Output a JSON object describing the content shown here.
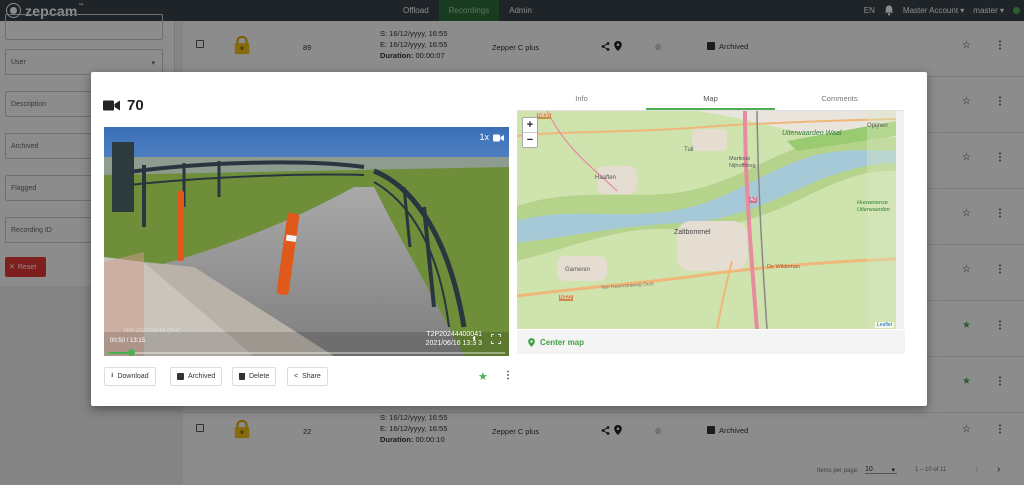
{
  "brand": {
    "name": "zepcam",
    "tm": "™"
  },
  "nav": [
    "Offload",
    "Recordings",
    "Admin"
  ],
  "topbar": {
    "lang": "EN",
    "account": "Master Account",
    "user": "master"
  },
  "filters": {
    "user": "User",
    "description": "Description",
    "archived": "Archived",
    "flagged": "Flagged",
    "recording_id": "Recording ID",
    "reset": "Reset"
  },
  "rows": [
    {
      "id": "89",
      "start": "S: 16/12/yyyy, 16:55",
      "end": "E: 16/12/yyyy, 16:55",
      "duration_label": "Duration:",
      "duration": "00:00:07",
      "device": "Zepper C plus",
      "status": "Archived"
    },
    {
      "id": "22",
      "start": "S: 16/12/yyyy, 16:55",
      "end": "E: 16/12/yyyy, 16:55",
      "duration_label": "Duration:",
      "duration": "00:00:10",
      "device": "Zepper C plus",
      "status": "Archived"
    }
  ],
  "pagination": {
    "label": "Items per page:",
    "per_page": "10",
    "range": "1 – 10 of 11"
  },
  "modal": {
    "title": "70",
    "tabs": [
      "Info",
      "Map",
      "Comments"
    ],
    "video": {
      "speed": "1x",
      "time": "00:50 / 13:15",
      "progress": 0.06,
      "overlay_id": "T2P20244400041",
      "overlay_date": "2021/06/16  13:3 3"
    },
    "buttons": {
      "download": "Download",
      "archived": "Archived",
      "delete": "Delete",
      "share": "Share"
    },
    "center_map": "Center map",
    "map": {
      "places": [
        "Haaften",
        "Tuil",
        "Martinus Nijhoffbrug",
        "Uiterwaarden Waal",
        "Opijnen",
        "Zaltbommel",
        "Gameren",
        "Hurwenense Uiterwaarden",
        "De Wildeman",
        "Van Heemstraweg Oost"
      ],
      "roads": [
        "A2",
        "N322",
        "N830"
      ],
      "attribution": "Leaflet"
    }
  },
  "colors": {
    "accent": "#4caf50",
    "danger": "#e53935",
    "topbar": "#37424a",
    "lock": "#f2c21a"
  }
}
